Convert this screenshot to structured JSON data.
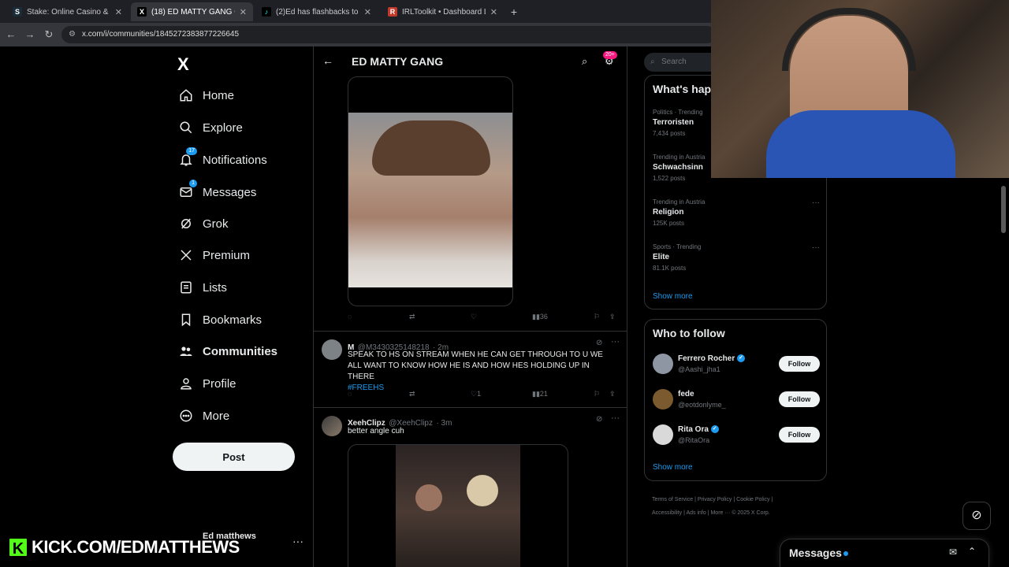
{
  "browser": {
    "tabs": [
      {
        "title": "Stake: Online Casino & Sports B",
        "favicon": "S"
      },
      {
        "title": "(18) ED MATTY GANG Commu",
        "favicon": "X"
      },
      {
        "title": "(2)Ed has flashbacks to the pac",
        "favicon": "♪"
      },
      {
        "title": "IRLToolkit • Dashboard Login",
        "favicon": "R"
      }
    ],
    "url": "x.com/i/communities/1845272383877226645"
  },
  "nav": {
    "logo": "X",
    "items": [
      {
        "label": "Home",
        "icon": "home-icon"
      },
      {
        "label": "Explore",
        "icon": "search-icon"
      },
      {
        "label": "Notifications",
        "icon": "bell-icon",
        "badge": "17"
      },
      {
        "label": "Messages",
        "icon": "envelope-icon",
        "badge": "1"
      },
      {
        "label": "Grok",
        "icon": "grok-icon"
      },
      {
        "label": "Premium",
        "icon": "x-icon"
      },
      {
        "label": "Lists",
        "icon": "list-icon"
      },
      {
        "label": "Bookmarks",
        "icon": "bookmark-icon"
      },
      {
        "label": "Communities",
        "icon": "communities-icon"
      },
      {
        "label": "Profile",
        "icon": "person-icon"
      },
      {
        "label": "More",
        "icon": "more-circle-icon"
      }
    ],
    "post_label": "Post",
    "account_name": "Ed matthews"
  },
  "feed": {
    "title": "ED MATTY GANG",
    "header_badge": "20+",
    "tweet1": {
      "views": "36"
    },
    "tweet2": {
      "name": "M",
      "handle": "@M3430325148218",
      "time": "· 2m",
      "text": "SPEAK TO HS ON STREAM WHEN HE CAN GET THROUGH TO U WE ALL WANT TO KNOW HOW HE IS AND HOW HES HOLDING UP IN THERE",
      "hashtag": "#FREEHS",
      "likes": "1",
      "views": "21"
    },
    "tweet3": {
      "name": "XeehClipz",
      "handle": "@XeehClipz",
      "time": "· 3m",
      "text": "better angle cuh"
    }
  },
  "right": {
    "search_placeholder": "Search",
    "happening_title": "What's hap",
    "trends": [
      {
        "category": "Politics · Trending",
        "name": "Terroristen",
        "count": "7,434 posts"
      },
      {
        "category": "Trending in Austria",
        "name": "Schwachsinn",
        "count": "1,522 posts"
      },
      {
        "category": "Trending in Austria",
        "name": "Religion",
        "count": "125K posts"
      },
      {
        "category": "Sports · Trending",
        "name": "Elite",
        "count": "81.1K posts"
      }
    ],
    "show_more": "Show more",
    "who_title": "Who to follow",
    "follow": [
      {
        "name": "Ferrero Rocher",
        "handle": "@Aashi_jha1",
        "verified": true
      },
      {
        "name": "fede",
        "handle": "@eotdonlyme_",
        "verified": false
      },
      {
        "name": "Rita Ora",
        "handle": "@RitaOra",
        "verified": true
      }
    ],
    "follow_label": "Follow",
    "footer": {
      "tos": "Terms of Service",
      "privacy": "Privacy Policy",
      "cookie": "Cookie Policy",
      "accessibility": "Accessibility",
      "ads": "Ads info",
      "more": "More ···",
      "copyright": "© 2025 X Corp."
    }
  },
  "dock": {
    "messages": "Messages"
  },
  "overlay": {
    "kick_text": "KICK.COM/EDMATTHEWS",
    "kick_logo": "K"
  },
  "colors": {
    "accent": "#1d9bf0",
    "kick": "#53fc18",
    "badge_pink": "#f91880"
  }
}
